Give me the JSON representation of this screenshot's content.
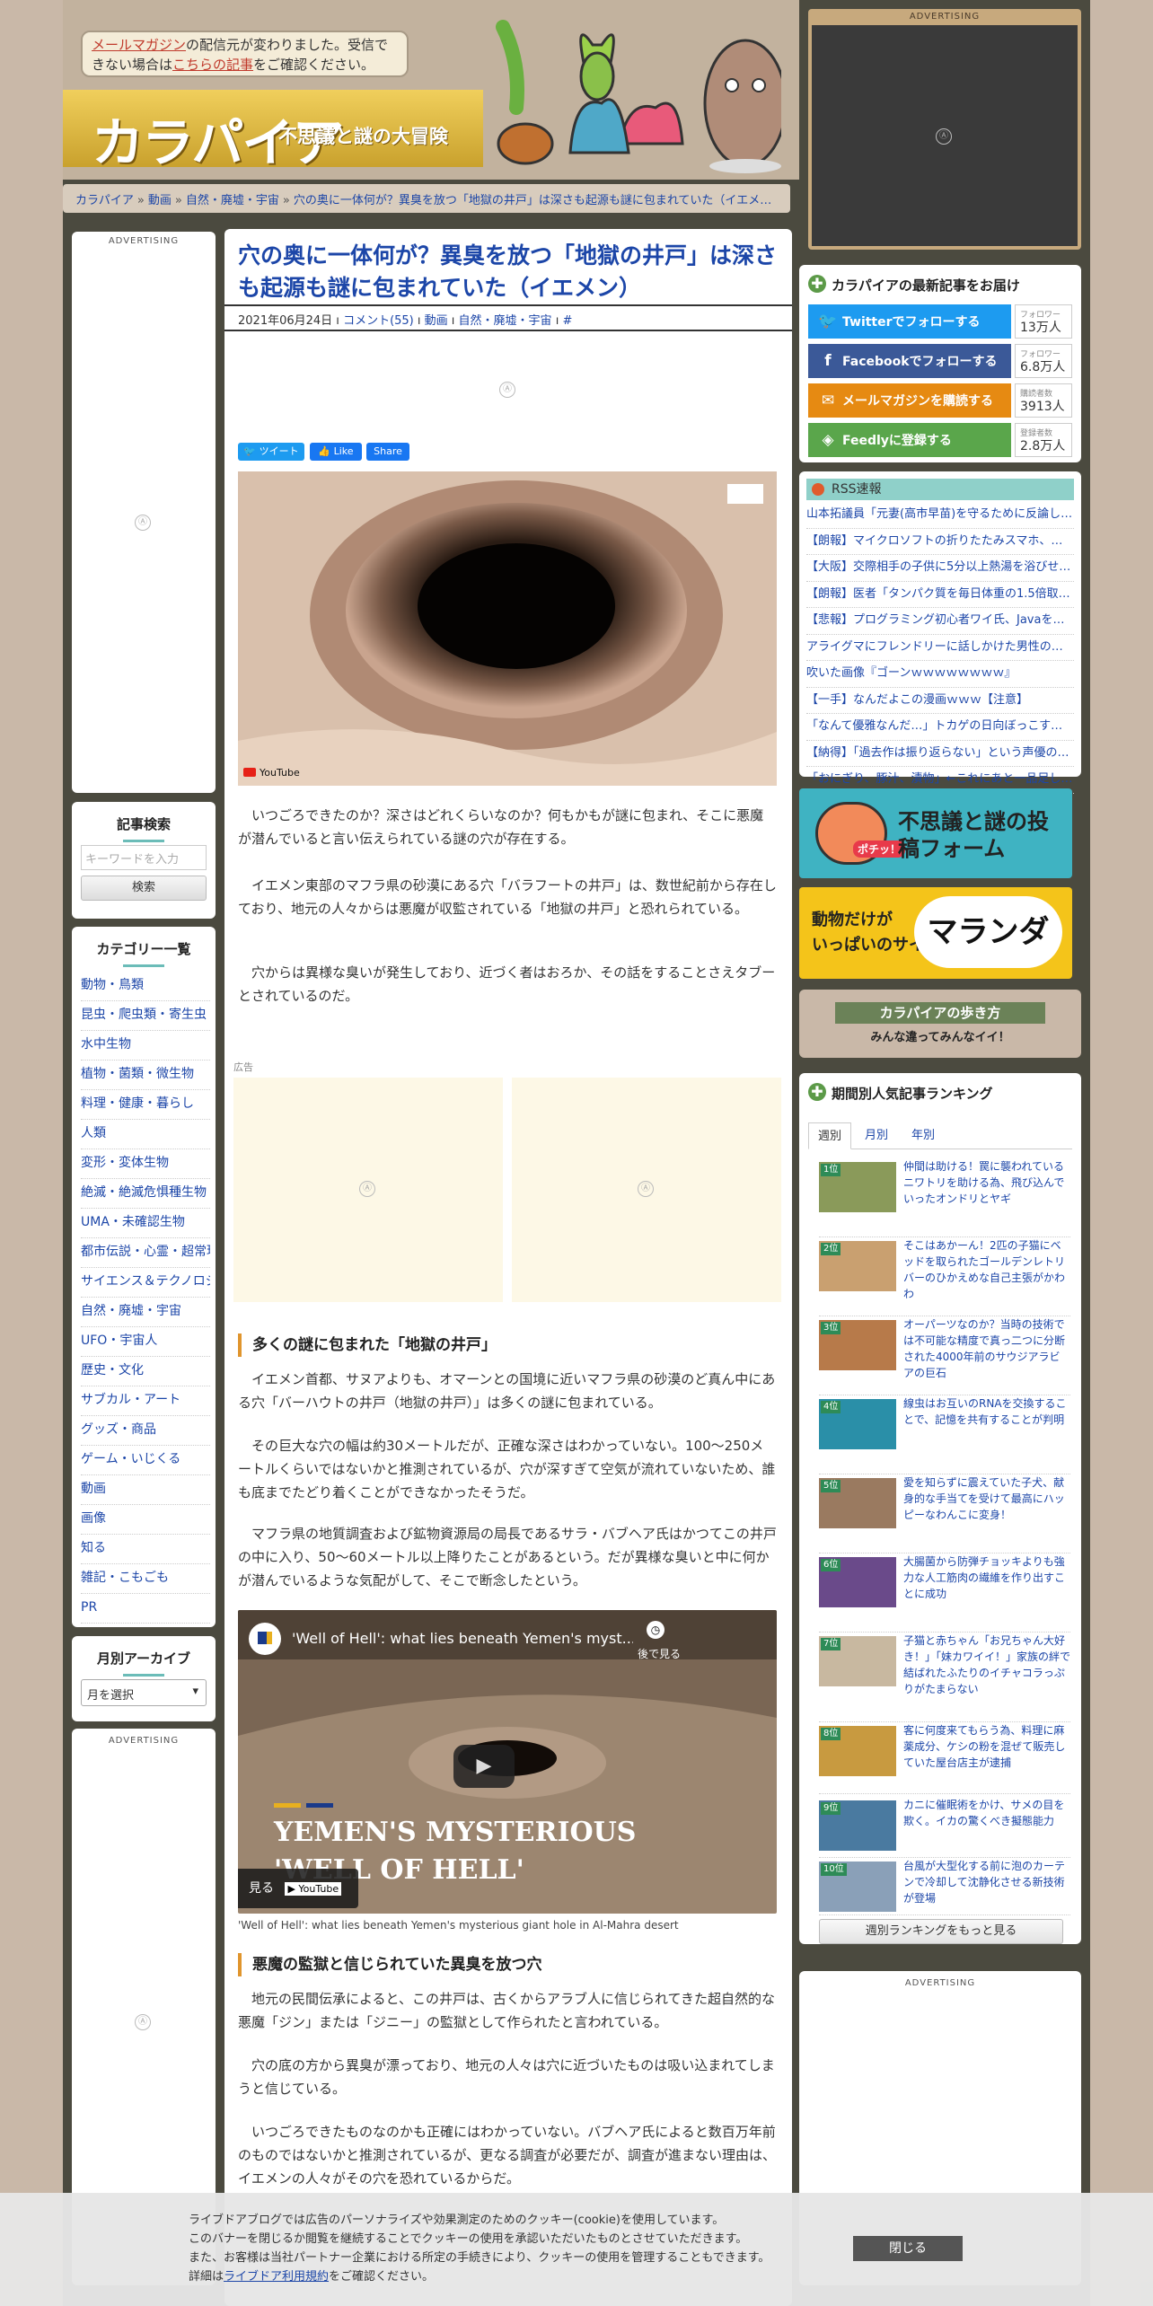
{
  "notice": {
    "mail_link": "メールマガジン",
    "text_1": "の配信元が変わりました。受信できない場合は",
    "article_link": "こちらの記事",
    "text_2": "をご確認ください。"
  },
  "site": {
    "logo": "カラパイア",
    "tagline": "不思議と謎の大冒険"
  },
  "breadcrumb": [
    "カラパイア",
    "動画",
    "自然・廃墟・宇宙",
    "穴の奥に一体何が？異臭を放つ「地獄の井戸」は深さも起源も謎に包まれていた（イエメン）"
  ],
  "left": {
    "adv1": "ADVERTISING",
    "search_title": "記事検索",
    "search_placeholder": "キーワードを入力",
    "search_button": "検索",
    "cat_title": "カテゴリー一覧",
    "categories": [
      "動物・鳥類",
      "昆虫・爬虫類・寄生虫",
      "水中生物",
      "植物・菌類・微生物",
      "料理・健康・暮らし",
      "人類",
      "変形・変体生物",
      "絶滅・絶滅危惧種生物",
      "UMA・未確認生物",
      "都市伝説・心霊・超常現象",
      "サイエンス＆テクノロジー",
      "自然・廃墟・宇宙",
      "UFO・宇宙人",
      "歴史・文化",
      "サブカル・アート",
      "グッズ・商品",
      "ゲーム・いじくる",
      "動画",
      "画像",
      "知る",
      "雑記・こもごも",
      "PR"
    ],
    "archive_title": "月別アーカイブ",
    "archive_select": "月を選択",
    "adv2": "ADVERTISING"
  },
  "article": {
    "title": "穴の奥に一体何が？異臭を放つ「地獄の井戸」は深さも起源も謎に包まれていた（イエメン）",
    "date": "2021年06月24日",
    "comments": "コメント(55)",
    "cat1": "動画",
    "cat2": "自然・廃墟・宇宙",
    "hash": "#",
    "share_tweet": "ツイート",
    "share_like": "Like",
    "share_share": "Share",
    "youtube": "YouTube",
    "p1": "いつごろできたのか？深さはどれくらいなのか？何もかもが謎に包まれ、そこに悪魔が潜んでいると言い伝えられている謎の穴が存在する。",
    "p2": "イエメン東部のマフラ県の砂漠にある穴「バラフートの井戸」は、数世紀前から存在しており、地元の人々からは悪魔が収監されている「地獄の井戸」と恐れられている。",
    "p3": "穴からは異様な臭いが発生しており、近づく者はおろか、その話をすることさえタブーとされているのだ。",
    "ad_label": "広告",
    "h2_1": "多くの謎に包まれた「地獄の井戸」",
    "p4": "イエメン首都、サヌアよりも、オマーンとの国境に近いマフラ県の砂漠のど真ん中にある穴「バーハウトの井戸（地獄の井戸）」は多くの謎に包まれている。",
    "p5": "その巨大な穴の幅は約30メートルだが、正確な深さはわかっていない。100～250メートルくらいではないかと推測されているが、穴が深すぎて空気が流れていないため、誰も底までたどり着くことができなかったそうだ。",
    "p6": "マフラ県の地質調査および鉱物資源局の局長であるサラ・バブヘア氏はかつてこの井戸の中に入り、50～60メートル以上降りたことがあるという。だが異様な臭いと中に何かが潜んでいるような気配がして、そこで断念したという。",
    "video_title": "'Well of Hell': what lies beneath Yemen's myst...",
    "video_later": "後で見る",
    "video_overlay_1": "YEMEN'S MYSTERIOUS",
    "video_overlay_2": "'WELL OF HELL'",
    "video_watch": "見る",
    "video_caption": "'Well of Hell': what lies beneath Yemen's mysterious giant hole in Al-Mahra desert",
    "h2_2": "悪魔の監獄と信じられていた異臭を放つ穴",
    "p7": "地元の民間伝承によると、この井戸は、古くからアラブ人に信じられてきた超自然的な悪魔「ジン」または「ジニー」の監獄として作られたと言われている。",
    "p8": "穴の底の方から異臭が漂っており、地元の人々は穴に近づいたものは吸い込まれてしまうと信じている。",
    "p9": "いつごろできたものなのかも正確にはわかっていない。バブヘア氏によると数百万年前のものではないかと推測されているが、更なる調査が必要だが、調査が進まない理由は、イエメンの人々がその穴を恐れているからだ。"
  },
  "right": {
    "top_adv": "ADVERTISING",
    "follow_title": "カラパイアの最新記事をお届け",
    "follow": [
      {
        "label": "Twitterでフォローする",
        "small": "フォロワー",
        "count": "13万人",
        "color": "#1d9bf0",
        "icon": "twitter-icon"
      },
      {
        "label": "Facebookでフォローする",
        "small": "フォロワー",
        "count": "6.8万人",
        "color": "#3b5998",
        "icon": "facebook-icon"
      },
      {
        "label": "メールマガジンを購読する",
        "small": "購読者数",
        "count": "3913人",
        "color": "#e68a12",
        "icon": "mail-icon"
      },
      {
        "label": "Feedlyに登録する",
        "small": "登録者数",
        "count": "2.8万人",
        "color": "#5aa64b",
        "icon": "feedly-icon"
      }
    ],
    "rss_title": "RSS速報",
    "rss": [
      "山本拓議員「元妻(高市早苗)を守るために反論し…",
      "【朗報】マイクロソフトの折りたたみスマホ、と…",
      "【大阪】交際相手の子供に5分以上熱湯を浴びせ…",
      "【朗報】医者「タンパク質を毎日体重の1.5倍取…",
      "【悲報】プログラミング初心者ワイ氏、Javaを…",
      "アライグマにフレンドリーに話しかけた男性の悲劇",
      "吹いた画像『ゴーンｗｗｗｗｗｗｗｗ』",
      "【一手】なんだよこの漫画ｗｗｗ【注意】",
      "「なんて優雅なんだ…」トカゲの日向ぼっこする…",
      "【納得】「過去作は振り返らない」という声優の…",
      "「おにぎり、豚汁、漬物」←これにあと一品足し…"
    ],
    "banner1": "不思議と謎の投稿フォーム",
    "banner1_badge": "ポチッ！",
    "banner2_a": "動物だけが",
    "banner2_b": "いっぱいのサイト",
    "banner2_logo": "マランダー",
    "guide_a": "カラパイアの歩き方",
    "guide_b": "みんな違ってみんなイイ！",
    "rank_title": "期間別人気記事ランキング",
    "tabs": [
      "週別",
      "月別",
      "年別"
    ],
    "ranking": [
      {
        "num": "1位",
        "text": "仲間は助ける！罠に襲われているニワトリを助ける為、飛び込んでいったオンドリとヤギ",
        "color": "#8a9a5a"
      },
      {
        "num": "2位",
        "text": "そこはあかーん！2匹の子猫にベッドを取られたゴールデンレトリバーのひかえめな自己主張がかわわ",
        "color": "#c9a070"
      },
      {
        "num": "3位",
        "text": "オーパーツなのか？当時の技術では不可能な精度で真っ二つに分断された4000年前のサウジアラビアの巨石",
        "color": "#b77a4a"
      },
      {
        "num": "4位",
        "text": "線虫はお互いのRNAを交換することで、記憶を共有することが判明",
        "color": "#2a8fa8"
      },
      {
        "num": "5位",
        "text": "愛を知らずに震えていた子犬、献身的な手当てを受けて最高にハッピーなわんこに変身！",
        "color": "#9a7a60"
      },
      {
        "num": "6位",
        "text": "大腸菌から防弾チョッキよりも強力な人工筋肉の繊維を作り出すことに成功",
        "color": "#6a4a8a"
      },
      {
        "num": "7位",
        "text": "子猫と赤ちゃん「お兄ちゃん大好き！」「妹カワイイ！」家族の絆で結ばれたふたりのイチャコラっぷりがたまらない",
        "color": "#c8b8a0"
      },
      {
        "num": "8位",
        "text": "客に何度来てもらう為、料理に麻薬成分、ケシの粉を混ぜて販売していた屋台店主が逮捕",
        "color": "#c89a40"
      },
      {
        "num": "9位",
        "text": "カニに催眠術をかけ、サメの目を欺く。イカの驚くべき擬態能力",
        "color": "#4a7aa0"
      },
      {
        "num": "10位",
        "text": "台風が大型化する前に泡のカーテンで冷却して沈静化させる新技術が登場",
        "color": "#8aa0b8"
      }
    ],
    "rank_more": "週別ランキングをもっと見る",
    "bottom_adv": "ADVERTISING"
  },
  "cookie": {
    "line1": "ライブドアブログでは広告のパーソナライズや効果測定のためのクッキー(cookie)を使用しています。",
    "line2": "このバナーを閉じるか閲覧を継続することでクッキーの使用を承認いただいたものとさせていただきます。",
    "line3": "また、お客様は当社パートナー企業における所定の手続きにより、クッキーの使用を管理することもできます。",
    "line4_pre": "詳細は",
    "line4_link": "ライブドア利用規約",
    "line4_post": "をご確認ください。",
    "close": "閉じる"
  }
}
